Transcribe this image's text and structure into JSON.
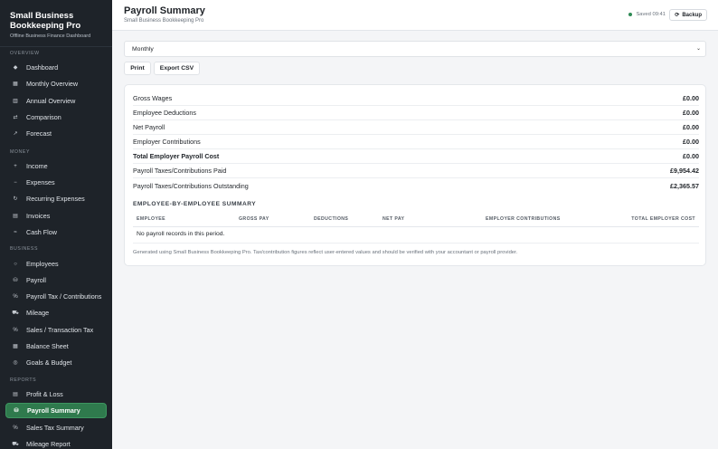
{
  "brand": {
    "title": "Small Business Bookkeeping Pro",
    "subtitle": "Offline Business Finance Dashboard"
  },
  "sidebar": {
    "sections": [
      {
        "label": "OVERVIEW",
        "items": [
          {
            "label": "Dashboard",
            "icon": "diamond-icon"
          },
          {
            "label": "Monthly Overview",
            "icon": "calendar-icon"
          },
          {
            "label": "Annual Overview",
            "icon": "chart-icon"
          },
          {
            "label": "Comparison",
            "icon": "swap-icon"
          },
          {
            "label": "Forecast",
            "icon": "trend-icon"
          }
        ]
      },
      {
        "label": "MONEY",
        "items": [
          {
            "label": "Income",
            "icon": "plus-icon"
          },
          {
            "label": "Expenses",
            "icon": "minus-icon"
          },
          {
            "label": "Recurring Expenses",
            "icon": "repeat-icon"
          },
          {
            "label": "Invoices",
            "icon": "invoice-icon"
          },
          {
            "label": "Cash Flow",
            "icon": "flow-icon"
          }
        ]
      },
      {
        "label": "BUSINESS",
        "items": [
          {
            "label": "Employees",
            "icon": "person-icon"
          },
          {
            "label": "Payroll",
            "icon": "wallet-icon"
          },
          {
            "label": "Payroll Tax / Contributions",
            "icon": "percent-icon"
          },
          {
            "label": "Mileage",
            "icon": "car-icon"
          },
          {
            "label": "Sales / Transaction Tax",
            "icon": "percent-icon"
          },
          {
            "label": "Balance Sheet",
            "icon": "sheet-icon"
          },
          {
            "label": "Goals & Budget",
            "icon": "target-icon"
          }
        ]
      },
      {
        "label": "REPORTS",
        "items": [
          {
            "label": "Profit & Loss",
            "icon": "report-icon"
          },
          {
            "label": "Payroll Summary",
            "icon": "wallet-icon",
            "active": true
          },
          {
            "label": "Sales Tax Summary",
            "icon": "percent-icon"
          },
          {
            "label": "Mileage Report",
            "icon": "car-icon"
          }
        ]
      }
    ]
  },
  "header": {
    "title": "Payroll Summary",
    "subtitle": "Small Business Bookkeeping Pro",
    "saved_status": "Saved 09:41",
    "backup_label": "Backup",
    "backup_icon": "refresh-icon"
  },
  "controls": {
    "period_value": "Monthly",
    "print_label": "Print",
    "export_label": "Export CSV"
  },
  "summary": {
    "rows": [
      {
        "label": "Gross Wages",
        "value": "£0.00"
      },
      {
        "label": "Employee Deductions",
        "value": "£0.00"
      },
      {
        "label": "Net Payroll",
        "value": "£0.00"
      },
      {
        "label": "Employer Contributions",
        "value": "£0.00"
      },
      {
        "label": "Total Employer Payroll Cost",
        "value": "£0.00",
        "bold": true
      },
      {
        "label": "Payroll Taxes/Contributions Paid",
        "value": "£9,954.42"
      },
      {
        "label": "Payroll Taxes/Contributions Outstanding",
        "value": "£2,365.57"
      }
    ],
    "employee_section_title": "EMPLOYEE-BY-EMPLOYEE SUMMARY",
    "columns": [
      "EMPLOYEE",
      "GROSS PAY",
      "DEDUCTIONS",
      "NET PAY",
      "EMPLOYER CONTRIBUTIONS",
      "TOTAL EMPLOYER COST"
    ],
    "empty_message": "No payroll records in this period.",
    "footnote": "Generated using Small Business Bookkeeping Pro. Tax/contribution figures reflect user-entered values and should be verified with your accountant or payroll provider."
  },
  "colors": {
    "sidebar_bg": "#1e2329",
    "accent": "#2f7a4d",
    "saved_dot": "#2f8a55"
  }
}
